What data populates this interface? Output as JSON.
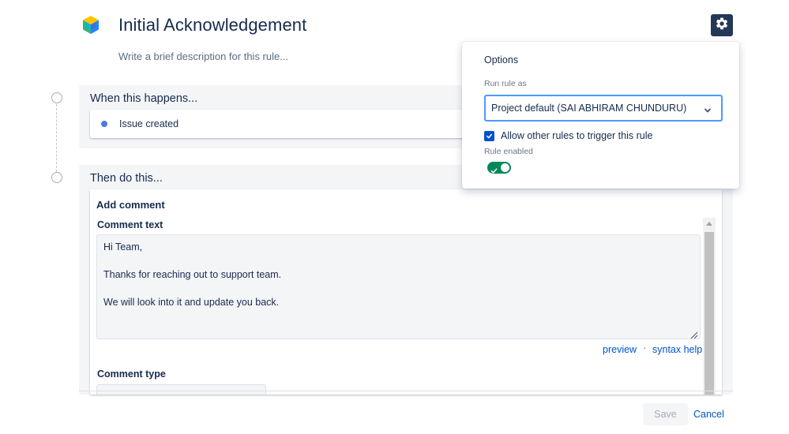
{
  "header": {
    "title": "Initial Acknowledgement",
    "description_placeholder": "Write a brief description for this rule...",
    "logo_icon": "automation-cube-icon",
    "settings_icon": "gear-icon"
  },
  "trigger_section": {
    "title": "When this happens...",
    "item": "Issue created"
  },
  "action_section": {
    "title": "Then do this...",
    "action_title": "Add comment",
    "comment_text_label": "Comment text",
    "comment_lines": [
      "Hi Team,",
      "Thanks for reaching out to support team.",
      "We will look into it and update you back."
    ],
    "preview_link": "preview",
    "separator": "·",
    "syntax_help_link": "syntax help",
    "comment_type_label": "Comment type"
  },
  "footer": {
    "save_label": "Save",
    "cancel_label": "Cancel"
  },
  "options": {
    "title": "Options",
    "run_rule_as_label": "Run rule as",
    "run_rule_as_value": "Project default (SAI ABHIRAM CHUNDURU)",
    "allow_trigger_label": "Allow other rules to trigger this rule",
    "allow_trigger_checked": true,
    "rule_enabled_label": "Rule enabled",
    "rule_enabled": true
  },
  "colors": {
    "primary": "#0052cc",
    "toggle_on": "#00875a",
    "gear_button_bg": "#253858",
    "trigger_dot": "#4c7ae0"
  }
}
